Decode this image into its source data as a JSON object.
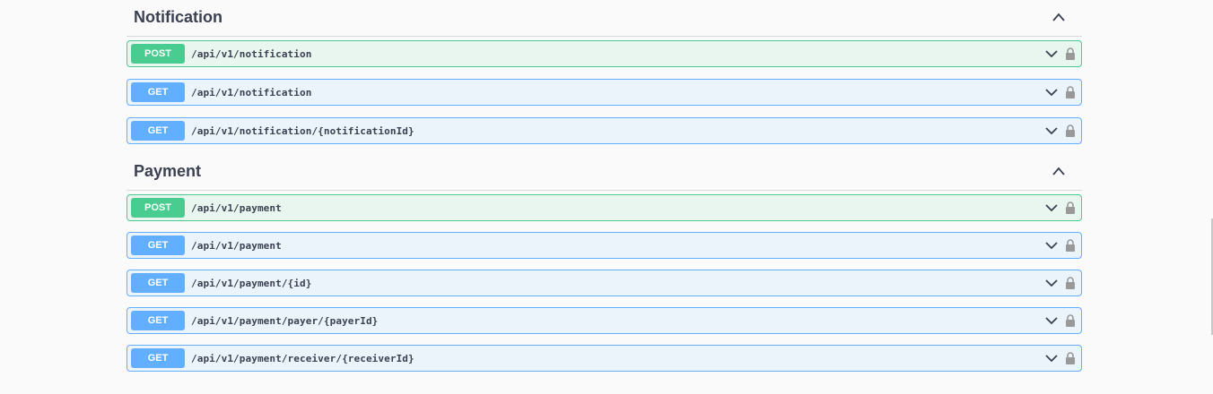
{
  "sections": [
    {
      "title": "Notification",
      "operations": [
        {
          "method": "POST",
          "path": "/api/v1/notification"
        },
        {
          "method": "GET",
          "path": "/api/v1/notification"
        },
        {
          "method": "GET",
          "path": "/api/v1/notification/{notificationId}"
        }
      ]
    },
    {
      "title": "Payment",
      "operations": [
        {
          "method": "POST",
          "path": "/api/v1/payment"
        },
        {
          "method": "GET",
          "path": "/api/v1/payment"
        },
        {
          "method": "GET",
          "path": "/api/v1/payment/{id}"
        },
        {
          "method": "GET",
          "path": "/api/v1/payment/payer/{payerId}"
        },
        {
          "method": "GET",
          "path": "/api/v1/payment/receiver/{receiverId}"
        }
      ]
    }
  ],
  "colors": {
    "post": "#49cc90",
    "get": "#61affe",
    "title": "#3b4151"
  },
  "icons": {
    "collapse": "chevron-up-icon",
    "expand": "chevron-down-icon",
    "auth": "lock-icon"
  }
}
